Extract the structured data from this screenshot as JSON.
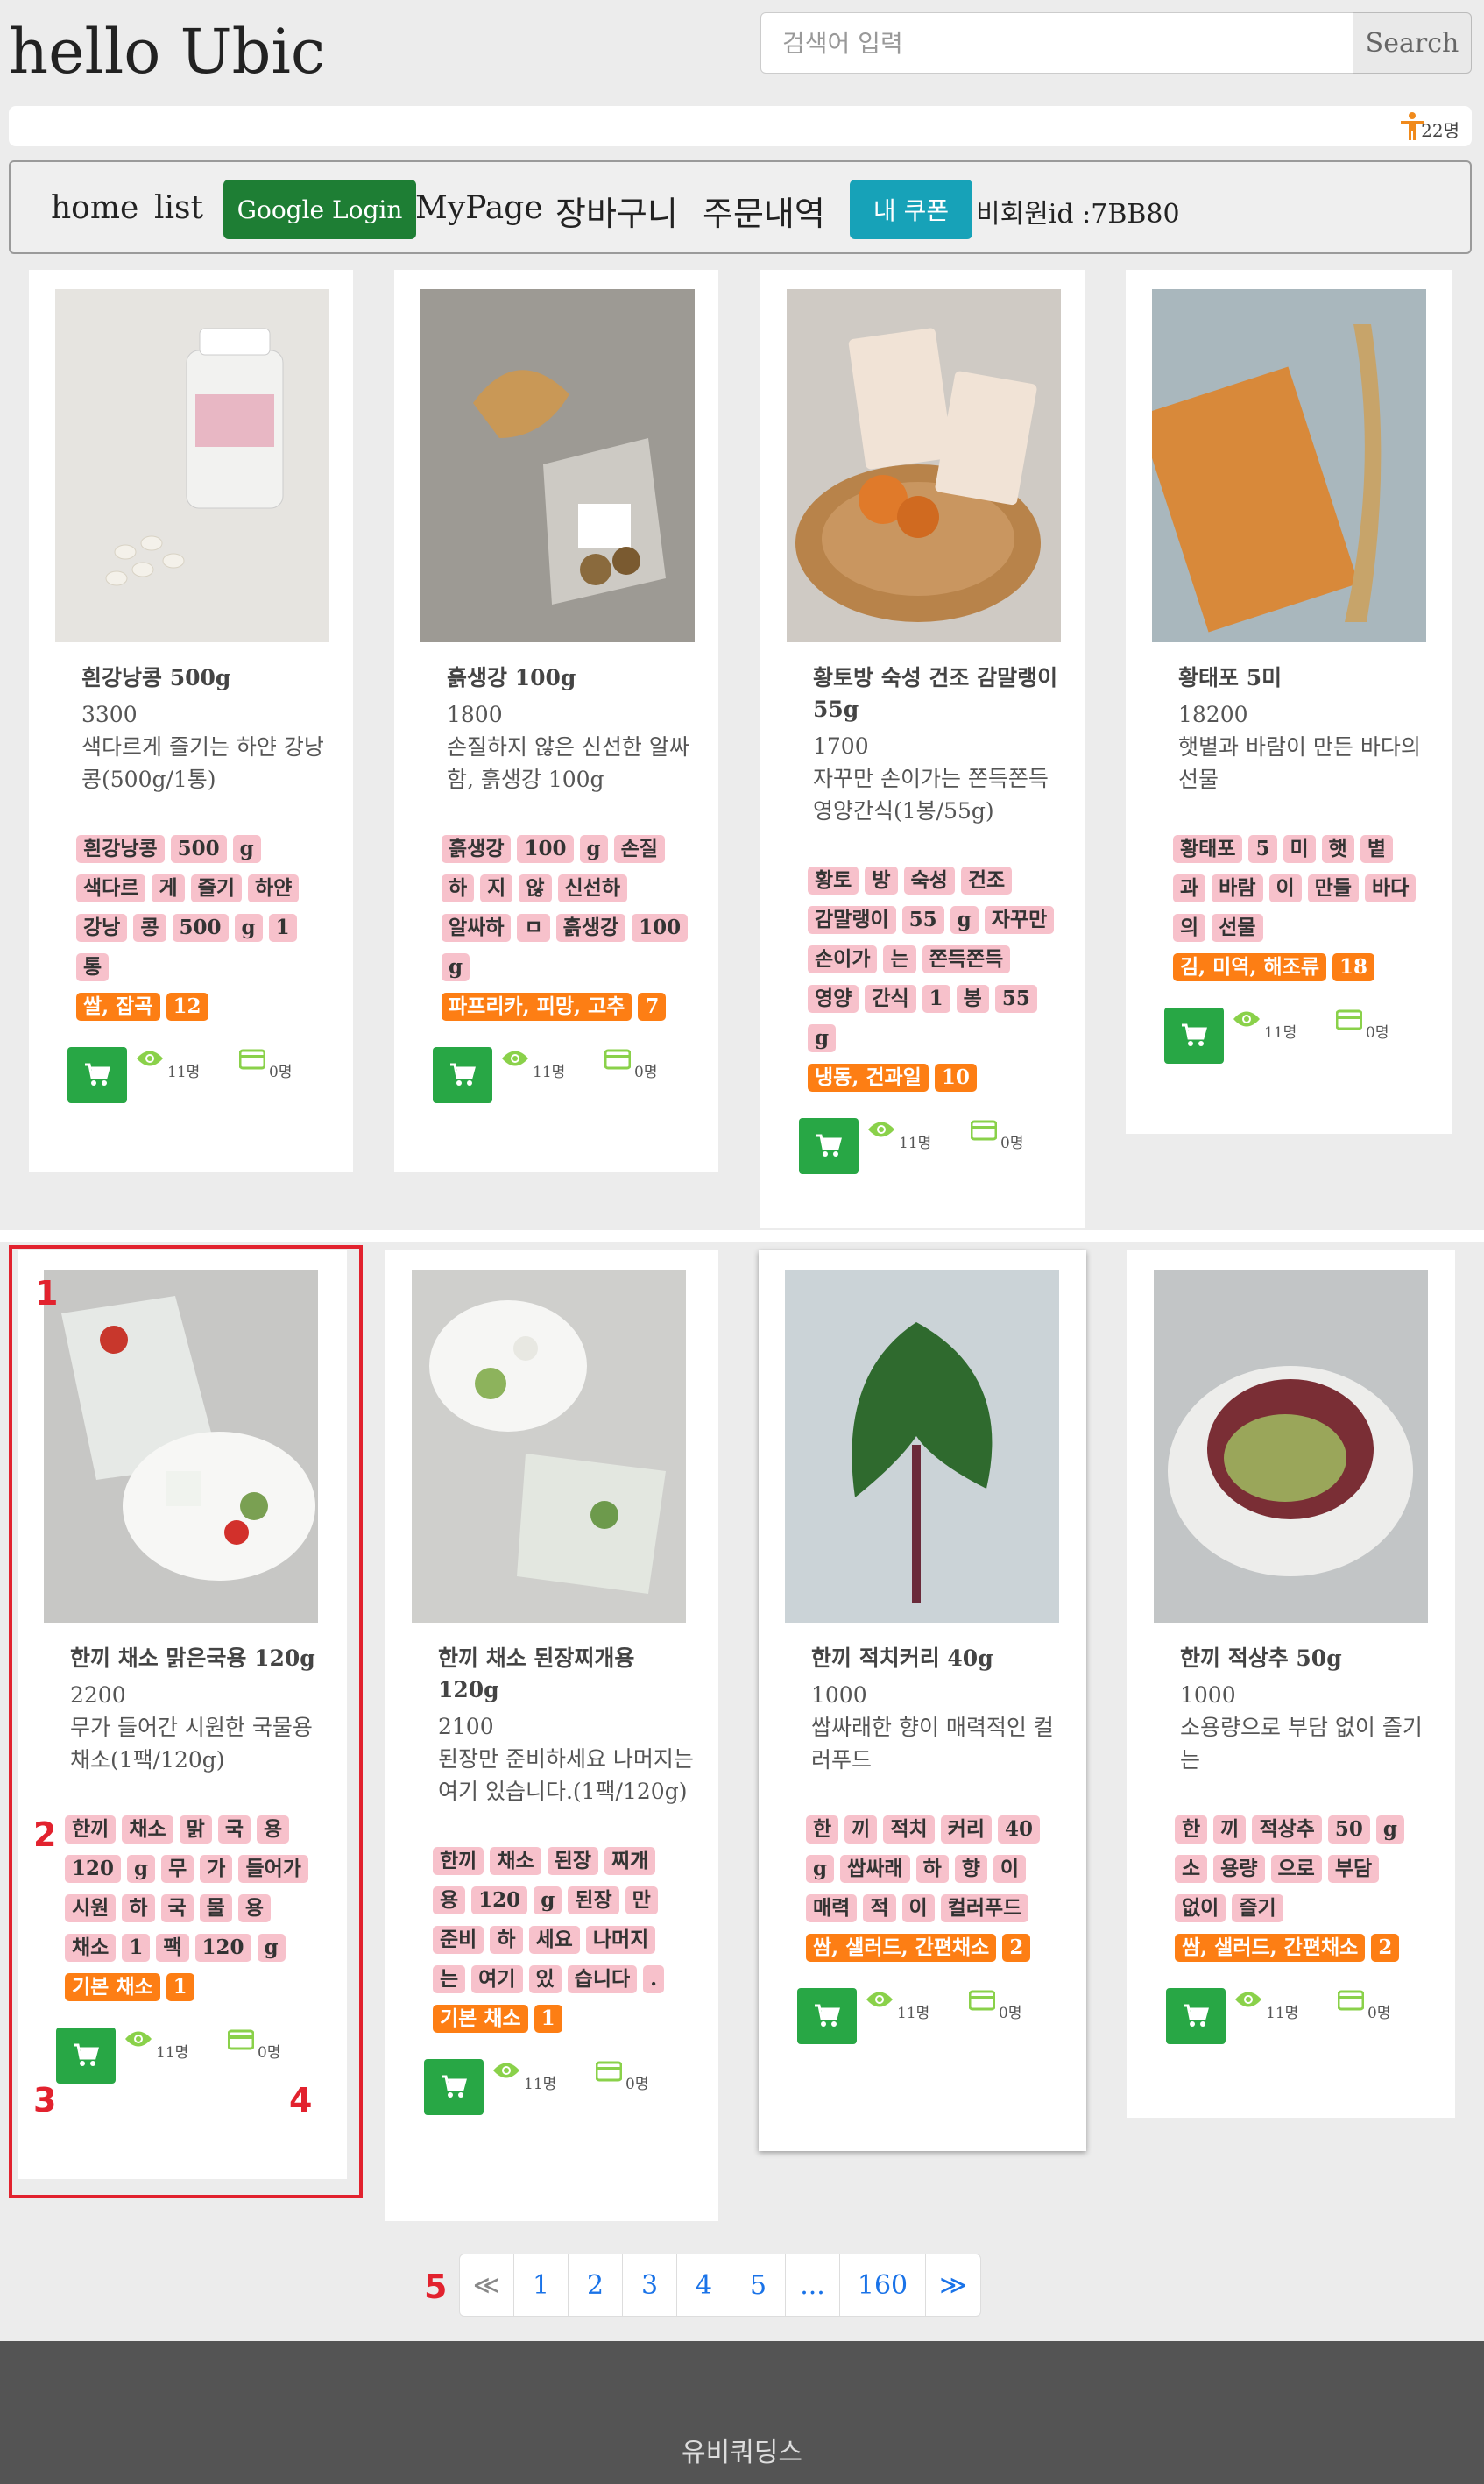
{
  "header": {
    "brand": "hello Ubic",
    "search_placeholder": "검색어 입력",
    "search_button": "Search",
    "visitor_count": "22명"
  },
  "nav": {
    "home": "home",
    "list": "list",
    "google_login": "Google Login",
    "mypage": "MyPage",
    "cart": "장바구니",
    "orders": "주문내역",
    "coupon": "내 쿠폰",
    "guest_id": "비회원id :7BB80"
  },
  "products": [
    {
      "title": "흰강낭콩 500g",
      "price": "3300",
      "desc": "색다르게 즐기는 하얀 강낭콩(500g/1통)",
      "tags": [
        "흰강낭콩",
        "500",
        "g",
        "색다르",
        "게",
        "즐기",
        "하얀",
        "강낭",
        "콩",
        "500",
        "g",
        "1",
        "통"
      ],
      "category": "쌀, 잡곡",
      "category_count": "12",
      "views": "11명",
      "buys": "0명"
    },
    {
      "title": "흙생강 100g",
      "price": "1800",
      "desc": "손질하지 않은 신선한 알싸함, 흙생강 100g",
      "tags": [
        "흙생강",
        "100",
        "g",
        "손질",
        "하",
        "지",
        "않",
        "신선하",
        "알싸하",
        "ㅁ",
        "흙생강",
        "100",
        "g"
      ],
      "category": "파프리카, 피망, 고추",
      "category_count": "7",
      "views": "11명",
      "buys": "0명"
    },
    {
      "title": "황토방 숙성 건조 감말랭이 55g",
      "price": "1700",
      "desc": "자꾸만 손이가는 쫀득쫀득 영양간식(1봉/55g)",
      "tags": [
        "황토",
        "방",
        "숙성",
        "건조",
        "감말랭이",
        "55",
        "g",
        "자꾸만",
        "손이가",
        "는",
        "쫀득쫀득",
        "영양",
        "간식",
        "1",
        "봉",
        "55",
        "g"
      ],
      "category": "냉동, 건과일",
      "category_count": "10",
      "views": "11명",
      "buys": "0명"
    },
    {
      "title": "황태포 5미",
      "price": "18200",
      "desc": "햇볕과 바람이 만든 바다의 선물",
      "tags": [
        "황태포",
        "5",
        "미",
        "햇",
        "볕",
        "과",
        "바람",
        "이",
        "만들",
        "바다",
        "의",
        "선물"
      ],
      "category": "김, 미역, 해조류",
      "category_count": "18",
      "views": "11명",
      "buys": "0명"
    },
    {
      "title": "한끼 채소 맑은국용 120g",
      "price": "2200",
      "desc": "무가 들어간 시원한 국물용 채소(1팩/120g)",
      "tags": [
        "한끼",
        "채소",
        "맑",
        "국",
        "용",
        "120",
        "g",
        "무",
        "가",
        "들어가",
        "시원",
        "하",
        "국",
        "물",
        "용",
        "채소",
        "1",
        "팩",
        "120",
        "g"
      ],
      "category": "기본 채소",
      "category_count": "1",
      "views": "11명",
      "buys": "0명"
    },
    {
      "title": "한끼 채소 된장찌개용 120g",
      "price": "2100",
      "desc": "된장만 준비하세요 나머지는 여기 있습니다.(1팩/120g)",
      "tags": [
        "한끼",
        "채소",
        "된장",
        "찌개",
        "용",
        "120",
        "g",
        "된장",
        "만",
        "준비",
        "하",
        "세요",
        "나머지",
        "는",
        "여기",
        "있",
        "습니다",
        "."
      ],
      "category": "기본 채소",
      "category_count": "1",
      "views": "11명",
      "buys": "0명"
    },
    {
      "title": "한끼 적치커리 40g",
      "price": "1000",
      "desc": "쌉싸래한 향이 매력적인 컬러푸드",
      "tags": [
        "한",
        "끼",
        "적치",
        "커리",
        "40",
        "g",
        "쌉싸래",
        "하",
        "향",
        "이",
        "매력",
        "적",
        "이",
        "컬러푸드"
      ],
      "category": "쌈, 샐러드, 간편채소",
      "category_count": "2",
      "views": "11명",
      "buys": "0명"
    },
    {
      "title": "한끼 적상추 50g",
      "price": "1000",
      "desc": "소용량으로 부담 없이 즐기는",
      "tags": [
        "한",
        "끼",
        "적상추",
        "50",
        "g",
        "소",
        "용량",
        "으로",
        "부담",
        "없이",
        "즐기"
      ],
      "category": "쌈, 샐러드, 간편채소",
      "category_count": "2",
      "views": "11명",
      "buys": "0명"
    }
  ],
  "annotations": [
    "1",
    "2",
    "3",
    "4",
    "5"
  ],
  "pagination": [
    "≪",
    "1",
    "2",
    "3",
    "4",
    "5",
    "...",
    "160",
    "≫"
  ],
  "footer": {
    "text": "유비쿼딩스"
  },
  "colors": {
    "cart_green": "#28a745",
    "tag_pink": "#f7c1cb",
    "tag_orange": "#fd7e14",
    "coupon_teal": "#17a2b8",
    "login_green": "#1e7e34",
    "annotation_red": "#e2222e"
  }
}
